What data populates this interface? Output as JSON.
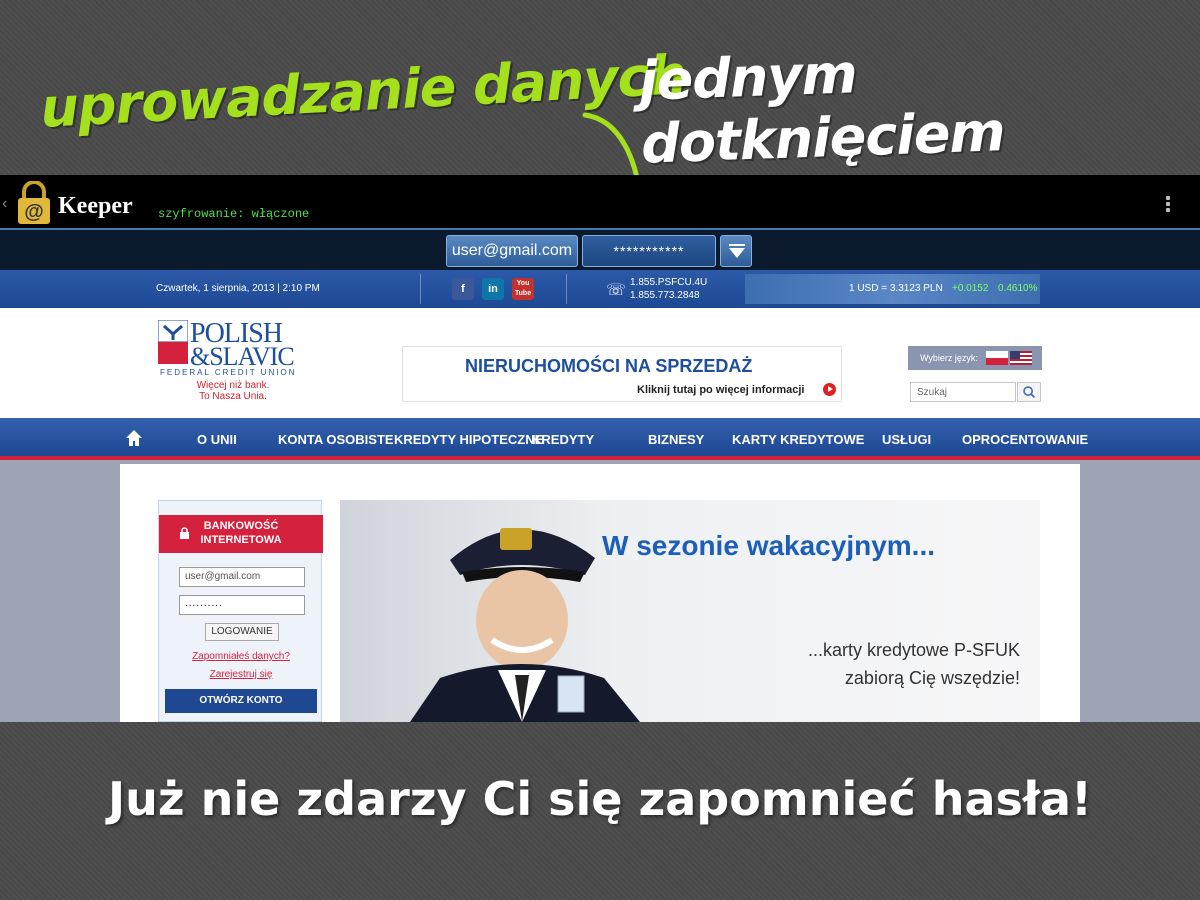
{
  "headline": {
    "green": "uprowadzanie danych",
    "white": "jednym dotknięciem"
  },
  "keeper": {
    "app_name": "Keeper",
    "status": "szyfrowanie: włączone",
    "fill_username": "user@gmail.com",
    "fill_password": "***********"
  },
  "site": {
    "date": "Czwartek, 1 sierpnia, 2013 | 2:10 PM",
    "social": [
      "f",
      "in",
      "You Tube"
    ],
    "phones": [
      "1.855.PSFCU.4U",
      "1.855.773.2848"
    ],
    "fx": {
      "rate": "1 USD = 3.3123 PLN",
      "change": "+0.0152",
      "change_pct": "0.4610%"
    },
    "logo": {
      "line1": "POLISH",
      "line2": "&SLAVIC",
      "sub": "FEDERAL CREDIT UNION",
      "tagline1": "Więcej niż bank.",
      "tagline2": "To Nasza Unia."
    },
    "banner": {
      "title": "NIERUCHOMOŚCI NA SPRZEDAŻ",
      "cta": "Kliknij tutaj po więcej informacji"
    },
    "language_label": "Wybierz język:",
    "search_placeholder": "Szukaj",
    "nav": [
      "O UNII",
      "KONTA OSOBISTE",
      "KREDYTY HIPOTECZNE",
      "KREDYTY",
      "BIZNESY",
      "KARTY KREDYTOWE",
      "USŁUGI",
      "OPROCENTOWANIE"
    ],
    "login": {
      "title_line1": "BANKOWOŚĆ",
      "title_line2": "INTERNETOWA",
      "username": "user@gmail.com",
      "password": "..........",
      "button": "LOGOWANIE",
      "forgot": "Zapomniałeś danych?",
      "register": "Zarejestruj się",
      "open_account": "OTWÓRZ KONTO"
    },
    "hero": {
      "title": "W sezonie wakacyjnym...",
      "line1": "...karty kredytowe P-SFUK",
      "line2": "zabiorą Cię wszędzie!"
    }
  },
  "caption": "Już nie zdarzy Ci się zapomnieć hasła!"
}
